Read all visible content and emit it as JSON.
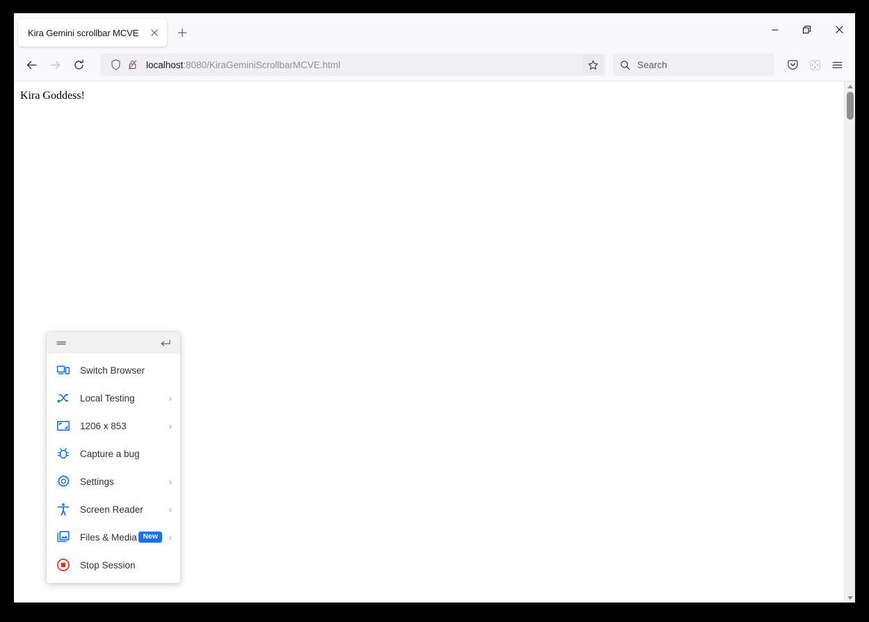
{
  "window": {
    "controls": {
      "minimize": "minimize-button",
      "restore": "restore-button",
      "close": "close-button"
    }
  },
  "tabstrip": {
    "tab": {
      "title": "Kira Gemini scrollbar MCVE",
      "close_label": "×"
    },
    "new_tab_label": "+"
  },
  "navbar": {
    "back_label": "←",
    "forward_label": "→",
    "reload_label": "↻",
    "url": {
      "host": "localhost",
      "path": ":8080/KiraGeminiScrollbarMCVE.html"
    },
    "search": {
      "placeholder": "Search"
    }
  },
  "content": {
    "heading": "Kira Goddess!"
  },
  "panel": {
    "items": [
      {
        "label": "Switch Browser",
        "icon": "switch-browser-icon",
        "chevron": "",
        "badge": ""
      },
      {
        "label": "Local Testing",
        "icon": "local-testing-icon",
        "chevron": "›",
        "badge": ""
      },
      {
        "label": "1206 x 853",
        "icon": "resolution-icon",
        "chevron": "›",
        "badge": ""
      },
      {
        "label": "Capture a bug",
        "icon": "bug-icon",
        "chevron": "",
        "badge": ""
      },
      {
        "label": "Settings",
        "icon": "gear-icon",
        "chevron": "›",
        "badge": ""
      },
      {
        "label": "Screen Reader",
        "icon": "accessibility-icon",
        "chevron": "›",
        "badge": ""
      },
      {
        "label": "Files & Media",
        "icon": "files-media-icon",
        "chevron": "›",
        "badge": "New"
      },
      {
        "label": "Stop Session",
        "icon": "stop-session-icon",
        "chevron": "",
        "badge": ""
      }
    ]
  },
  "colors": {
    "accent_blue": "#1a73e8",
    "badge_blue": "#1a73e8",
    "stop_red": "#d93025",
    "toolbar_bg": "#f9f9fb",
    "urlbar_bg": "#f0f0f4"
  }
}
